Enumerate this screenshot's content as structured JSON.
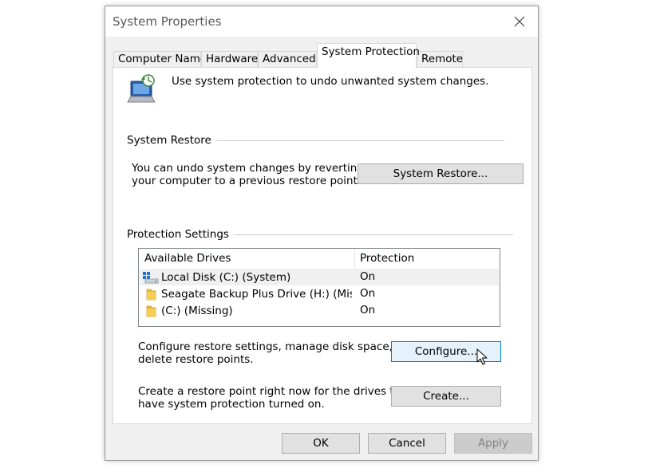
{
  "window": {
    "title": "System Properties"
  },
  "tabs": [
    {
      "label": "Computer Name"
    },
    {
      "label": "Hardware"
    },
    {
      "label": "Advanced"
    },
    {
      "label": "System Protection"
    },
    {
      "label": "Remote"
    }
  ],
  "active_tab": "System Protection",
  "intro": {
    "icon": "system-protection-icon",
    "text": "Use system protection to undo unwanted system changes."
  },
  "system_restore": {
    "group_title": "System Restore",
    "description_line1": "You can undo system changes by reverting",
    "description_line2": "your computer to a previous restore point.",
    "button_label": "System Restore..."
  },
  "protection_settings": {
    "group_title": "Protection Settings",
    "columns": [
      "Available Drives",
      "Protection"
    ],
    "drives": [
      {
        "name": "Local Disk (C:) (System)",
        "protection": "On",
        "icon": "system-drive-icon"
      },
      {
        "name": "Seagate Backup Plus Drive (H:) (Missi...",
        "protection": "On",
        "icon": "folder-icon"
      },
      {
        "name": "(C:) (Missing)",
        "protection": "On",
        "icon": "folder-icon"
      }
    ],
    "configure_desc_line1": "Configure restore settings, manage disk space, and",
    "configure_desc_line2": "delete restore points.",
    "configure_button": "Configure...",
    "create_desc_line1": "Create a restore point right now for the drives that",
    "create_desc_line2": "have system protection turned on.",
    "create_button": "Create..."
  },
  "footer": {
    "ok": "OK",
    "cancel": "Cancel",
    "apply": "Apply"
  },
  "colors": {
    "focus_border": "#0078d7",
    "focus_fill": "#e5f1fb",
    "button_fill": "#e1e1e1",
    "disabled_text": "#838383"
  }
}
